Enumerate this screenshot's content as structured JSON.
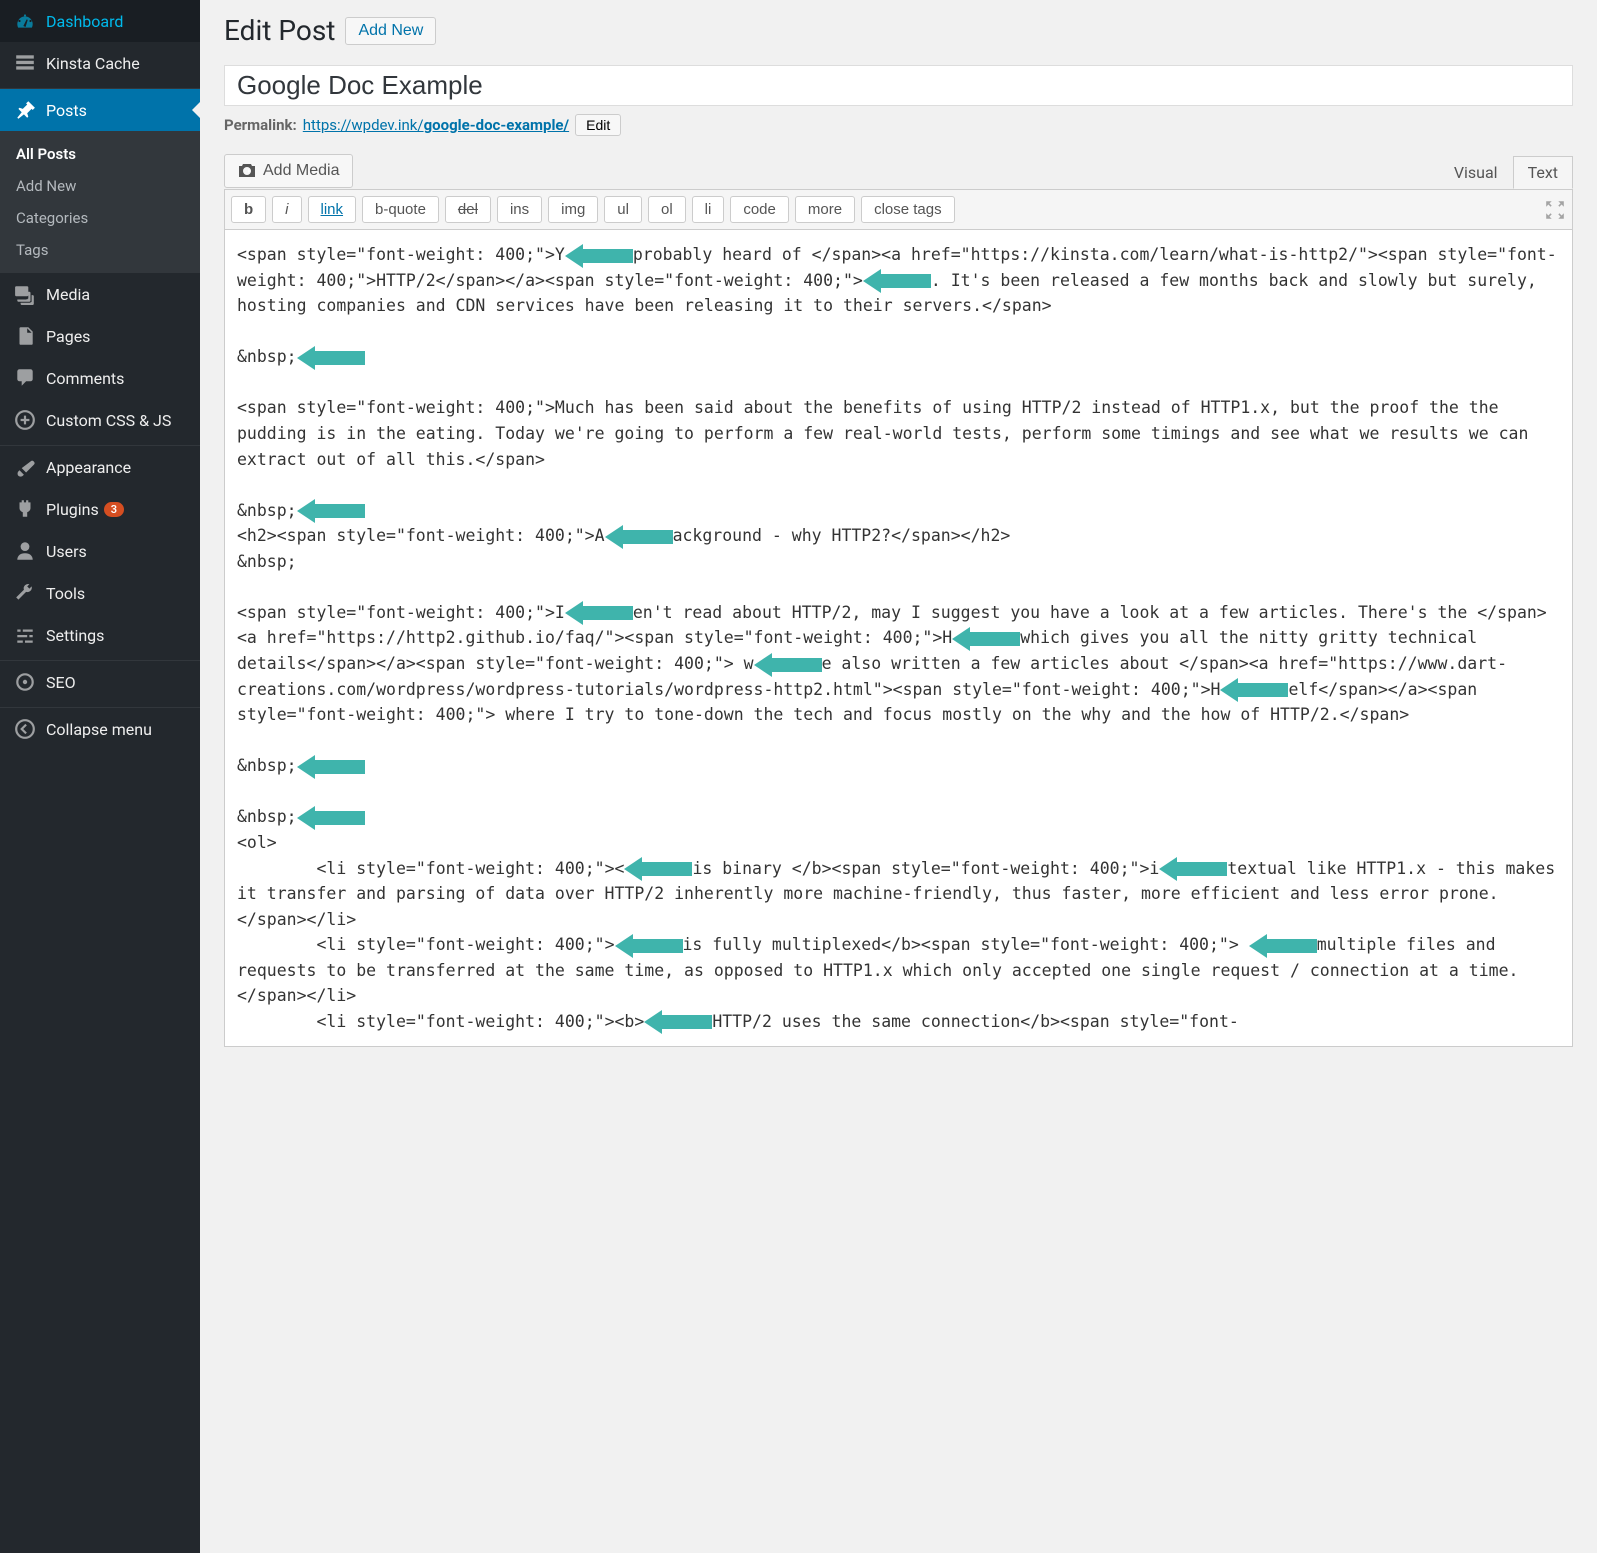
{
  "sidebar": {
    "items": [
      {
        "label": "Dashboard",
        "icon": "dashboard"
      },
      {
        "label": "Kinsta Cache",
        "icon": "cache"
      },
      {
        "label": "Posts",
        "icon": "pin",
        "current": true,
        "submenu": [
          {
            "label": "All Posts",
            "active": true
          },
          {
            "label": "Add New"
          },
          {
            "label": "Categories"
          },
          {
            "label": "Tags"
          }
        ]
      },
      {
        "label": "Media",
        "icon": "media"
      },
      {
        "label": "Pages",
        "icon": "pages"
      },
      {
        "label": "Comments",
        "icon": "comments"
      },
      {
        "label": "Custom CSS & JS",
        "icon": "plus"
      },
      {
        "label": "Appearance",
        "icon": "brush"
      },
      {
        "label": "Plugins",
        "icon": "plug",
        "badge": "3"
      },
      {
        "label": "Users",
        "icon": "user"
      },
      {
        "label": "Tools",
        "icon": "wrench"
      },
      {
        "label": "Settings",
        "icon": "sliders"
      },
      {
        "label": "SEO",
        "icon": "seo"
      },
      {
        "label": "Collapse menu",
        "icon": "collapse"
      }
    ]
  },
  "heading": {
    "title": "Edit Post",
    "add_new": "Add New"
  },
  "post_title": "Google Doc Example",
  "permalink": {
    "label": "Permalink:",
    "base": "https://wpdev.ink/",
    "slug": "google-doc-example/",
    "edit": "Edit"
  },
  "media_button": "Add Media",
  "tabs": {
    "visual": "Visual",
    "text": "Text",
    "active": "text"
  },
  "quicktags": [
    "b",
    "i",
    "link",
    "b-quote",
    "del",
    "ins",
    "img",
    "ul",
    "ol",
    "li",
    "code",
    "more",
    "close tags"
  ],
  "content": "<span style=\"font-weight: 400;\">Y[ARR]probably heard of </span><a href=\"https://kinsta.com/learn/what-is-http2/\"><span style=\"font-weight: 400;\">HTTP/2</span></a><span style=\"font-weight: 400;\">[ARR]. It's been released a few months back and slowly but surely, hosting companies and CDN services have been releasing it to their servers.</span>\n\n&nbsp;[ARR]\n\n<span style=\"font-weight: 400;\">Much has been said about the benefits of using HTTP/2 instead of HTTP1.x, but the proof the the pudding is in the eating. Today we're going to perform a few real-world tests, perform some timings and see what we results we can extract out of all this.</span>\n\n&nbsp;[ARR]\n<h2><span style=\"font-weight: 400;\">A[ARR]ackground - why HTTP2?</span></h2>\n&nbsp;\n\n<span style=\"font-weight: 400;\">I[ARR]en't read about HTTP/2, may I suggest you have a look at a few articles. There's the </span><a href=\"https://http2.github.io/faq/\"><span style=\"font-weight: 400;\">H[ARR]which gives you all the nitty gritty technical details</span></a><span style=\"font-weight: 400;\"> w[ARR]e also written a few articles about </span><a href=\"https://www.dart-creations.com/wordpress/wordpress-tutorials/wordpress-http2.html\"><span style=\"font-weight: 400;\">H[ARR]elf</span></a><span style=\"font-weight: 400;\"> where I try to tone-down the tech and focus mostly on the why and the how of HTTP/2.</span>\n\n&nbsp;[ARR]\n\n&nbsp;[ARR]\n<ol>\n \t<li style=\"font-weight: 400;\"><[ARR]is binary </b><span style=\"font-weight: 400;\">i[ARR]textual like HTTP1.x - this makes it transfer and parsing of data over HTTP/2 inherently more machine-friendly, thus faster, more efficient and less error prone.</span></li>\n \t<li style=\"font-weight: 400;\">[ARR]is fully multiplexed</b><span style=\"font-weight: 400;\"> [ARR]multiple files and requests to be transferred at the same time, as opposed to HTTP1.x which only accepted one single request / connection at a time.</span></li>\n \t<li style=\"font-weight: 400;\"><b>[ARR]HTTP/2 uses the same connection</b><span style=\"font-"
}
